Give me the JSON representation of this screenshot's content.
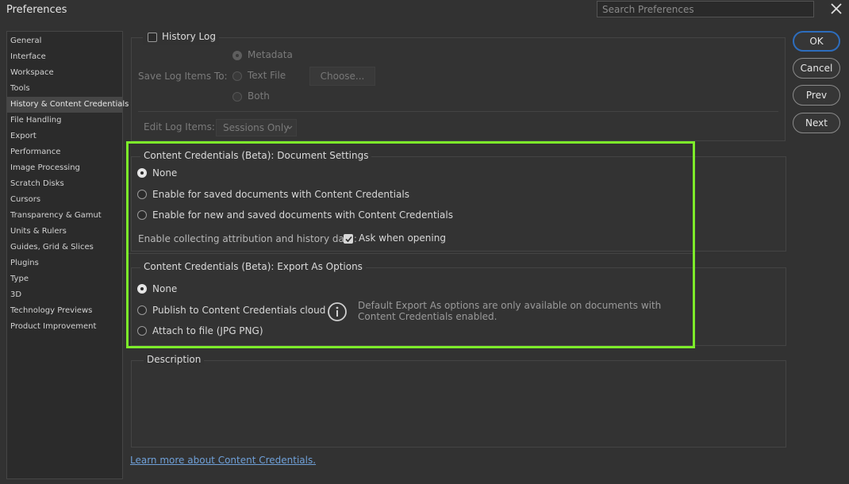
{
  "window": {
    "title": "Preferences",
    "search_placeholder": "Search Preferences",
    "close_icon": "close-icon"
  },
  "sidebar": {
    "items": [
      {
        "label": "General"
      },
      {
        "label": "Interface"
      },
      {
        "label": "Workspace"
      },
      {
        "label": "Tools"
      },
      {
        "label": "History & Content Credentials",
        "selected": true
      },
      {
        "label": "File Handling"
      },
      {
        "label": "Export"
      },
      {
        "label": "Performance"
      },
      {
        "label": "Image Processing"
      },
      {
        "label": "Scratch Disks"
      },
      {
        "label": "Cursors"
      },
      {
        "label": "Transparency & Gamut"
      },
      {
        "label": "Units & Rulers"
      },
      {
        "label": "Guides, Grid & Slices"
      },
      {
        "label": "Plugins"
      },
      {
        "label": "Type"
      },
      {
        "label": "3D"
      },
      {
        "label": "Technology Previews"
      },
      {
        "label": "Product Improvement"
      }
    ]
  },
  "buttons": {
    "ok": "OK",
    "cancel": "Cancel",
    "prev": "Prev",
    "next": "Next"
  },
  "history_log": {
    "label": "History Log",
    "checked": false,
    "save_label": "Save Log Items To:",
    "options": [
      "Metadata",
      "Text File",
      "Both"
    ],
    "selected": "Metadata",
    "choose_label": "Choose...",
    "edit_label": "Edit Log Items:",
    "edit_value": "Sessions Only"
  },
  "doc_settings": {
    "legend": "Content Credentials (Beta): Document Settings",
    "options": [
      "None",
      "Enable for saved documents with Content Credentials",
      "Enable for new and saved documents with Content Credentials"
    ],
    "selected": "None",
    "collect_label": "Enable collecting attribution and history data:",
    "ask_label": "Ask when opening",
    "ask_checked": true
  },
  "export_options": {
    "legend": "Content Credentials (Beta): Export As Options",
    "options": [
      "None",
      "Publish to Content Credentials cloud",
      "Attach to file (JPG  PNG)"
    ],
    "selected": "None",
    "info_text": "Default Export As options are only available on documents with Content Credentials enabled."
  },
  "description": {
    "legend": "Description"
  },
  "link": "Learn more about Content Credentials.",
  "colors": {
    "highlight": "#7dec2a",
    "link": "#6fa0d8",
    "primary_border": "#2d6dbd"
  }
}
